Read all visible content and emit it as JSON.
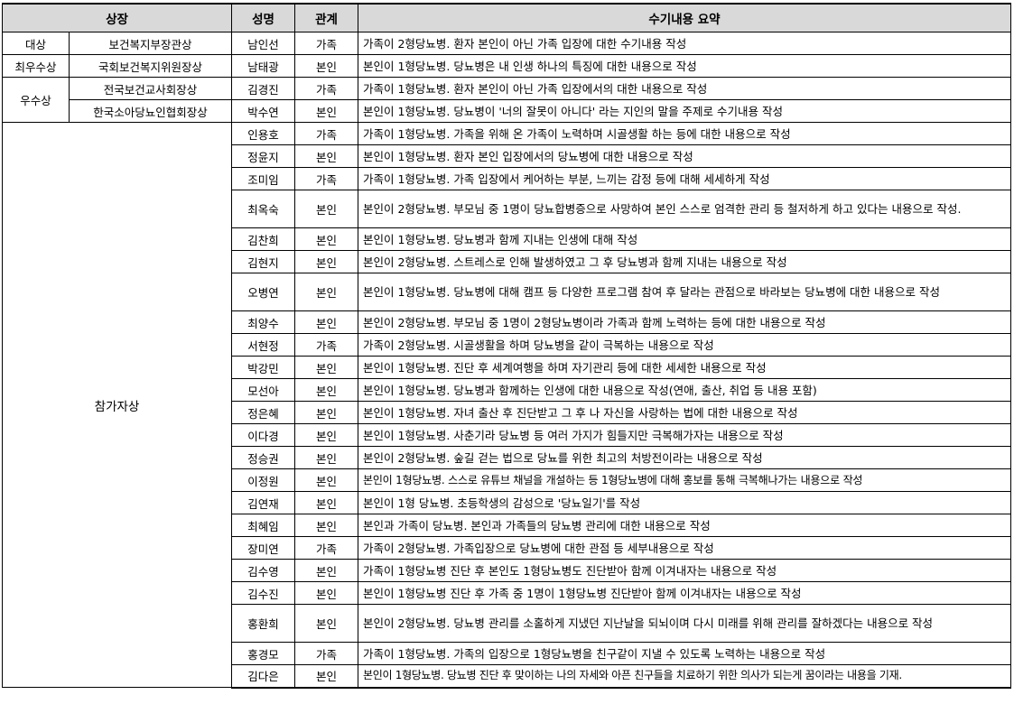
{
  "headers": {
    "award": "상장",
    "name": "성명",
    "relation": "관계",
    "summary": "수기내용 요약"
  },
  "rows": [
    {
      "award_a": "대상",
      "award_b": "보건복지부장관상",
      "name": "남인선",
      "relation": "가족",
      "summary": "가족이 2형당뇨병. 환자 본인이 아닌 가족 입장에 대한 수기내용 작성"
    },
    {
      "award_a": "최우수상",
      "award_b": "국회보건복지위원장상",
      "name": "남태광",
      "relation": "본인",
      "summary": "본인이 1형당뇨병. 당뇨병은 내 인생 하나의 특징에 대한 내용으로 작성"
    },
    {
      "award_a": "우수상",
      "award_b": "전국보건교사회장상",
      "name": "김경진",
      "relation": "가족",
      "summary": "가족이 1형당뇨병. 환자 본인이 아닌 가족 입장에서의 대한 내용으로 작성"
    },
    {
      "award_b": "한국소아당뇨인협회장상",
      "name": "박수연",
      "relation": "본인",
      "summary": "본인이 1형당뇨병. 당뇨병이 '너의 잘못이 아니다' 라는 지인의 말을 주제로 수기내용 작성"
    },
    {
      "award_a": "참가자상",
      "name": "인용호",
      "relation": "가족",
      "summary": "가족이 1형당뇨병. 가족을 위해 온 가족이 노력하며 시골생활 하는 등에 대한 내용으로 작성"
    },
    {
      "name": "정윤지",
      "relation": "본인",
      "summary": "본인이 1형당뇨병. 환자 본인 입장에서의 당뇨병에 대한 내용으로 작성"
    },
    {
      "name": "조미임",
      "relation": "가족",
      "summary": "가족이 1형당뇨병. 가족 입장에서 케어하는 부분, 느끼는 감정 등에 대해 세세하게 작성"
    },
    {
      "name": "최옥숙",
      "relation": "본인",
      "summary": "본인이 2형당뇨병. 부모님 중 1명이 당뇨합병증으로 사망하여 본인 스스로 엄격한 관리 등 철저하게 하고 있다는 내용으로 작성."
    },
    {
      "name": "김찬희",
      "relation": "본인",
      "summary": "본인이 1형당뇨병. 당뇨병과 함께 지내는 인생에 대해 작성"
    },
    {
      "name": "김현지",
      "relation": "본인",
      "summary": "본인이 2형당뇨병. 스트레스로 인해 발생하였고 그 후 당뇨병과 함께 지내는 내용으로 작성"
    },
    {
      "name": "오병연",
      "relation": "본인",
      "summary": "본인이 1형당뇨병. 당뇨병에 대해 캠프 등 다양한 프로그램 참여 후 달라는 관점으로 바라보는 당뇨병에 대한 내용으로 작성"
    },
    {
      "name": "최양수",
      "relation": "본인",
      "summary": "본인이 2형당뇨병. 부모님 중 1명이 2형당뇨병이라 가족과 함께 노력하는 등에 대한 내용으로 작성"
    },
    {
      "name": "서현정",
      "relation": "가족",
      "summary": "가족이 2형당뇨병. 시골생활을 하며 당뇨병을 같이 극복하는 내용으로 작성"
    },
    {
      "name": "박강민",
      "relation": "본인",
      "summary": "본인이 1형당뇨병. 진단 후 세계여행을 하며 자기관리 등에 대한 세세한 내용으로 작성"
    },
    {
      "name": "모선아",
      "relation": "본인",
      "summary": "본인이 1형당뇨병. 당뇨병과 함께하는 인생에 대한 내용으로 작성(연애, 출산, 취업 등 내용 포함)"
    },
    {
      "name": "정은혜",
      "relation": "본인",
      "summary": "본인이 1형당뇨병. 자녀 출산 후 진단받고 그 후 나 자신을 사랑하는 법에 대한 내용으로 작성"
    },
    {
      "name": "이다경",
      "relation": "본인",
      "summary": "본인이 1형당뇨병. 사춘기라 당뇨병 등 여러 가지가 힘들지만 극복해가자는 내용으로 작성"
    },
    {
      "name": "정승권",
      "relation": "본인",
      "summary": "본인이 2형당뇨병. 숲길 걷는 법으로 당뇨를 위한 최고의 처방전이라는 내용으로 작성"
    },
    {
      "name": "이정원",
      "relation": "본인",
      "summary": "본인이 1형당뇨병. 스스로 유튜브 채널을 개설하는 등 1형당뇨병에 대해 홍보를 통해 극복해나가는 내용으로 작성"
    },
    {
      "name": "김연재",
      "relation": "본인",
      "summary": "본인이 1형 당뇨병. 초등학생의 감성으로 '당뇨일기'를 작성"
    },
    {
      "name": "최혜임",
      "relation": "본인",
      "summary": "본인과 가족이 당뇨병. 본인과 가족들의 당뇨병 관리에 대한 내용으로 작성"
    },
    {
      "name": "장미연",
      "relation": "가족",
      "summary": "가족이 2형당뇨병. 가족입장으로 당뇨병에 대한 관점 등 세부내용으로 작성"
    },
    {
      "name": "김수영",
      "relation": "본인",
      "summary": "가족이 1형당뇨병 진단 후 본인도 1형당뇨병도 진단받아 함께 이겨내자는 내용으로 작성"
    },
    {
      "name": "김수진",
      "relation": "본인",
      "summary": "본인이 1형당뇨병 진단 후 가족 중 1명이 1형당뇨병 진단받아 함께 이겨내자는 내용으로 작성"
    },
    {
      "name": "홍환희",
      "relation": "본인",
      "summary": "본인이 2형당뇨병. 당뇨병 관리를 소홀하게 지냈던 지난날을 되뇌이며 다시 미래를 위해 관리를 잘하겠다는 내용으로 작성"
    },
    {
      "name": "홍경모",
      "relation": "가족",
      "summary": "가족이 1형당뇨병. 가족의 입장으로 1형당뇨병을 친구같이 지낼 수 있도록 노력하는 내용으로 작성"
    },
    {
      "name": "김다은",
      "relation": "본인",
      "summary": "본인이 1형당뇨병. 당뇨병 진단 후 맞이하는 나의 자세와 아픈 친구들을 치료하기 위한 의사가 되는게 꿈이라는 내용을 기재."
    }
  ]
}
